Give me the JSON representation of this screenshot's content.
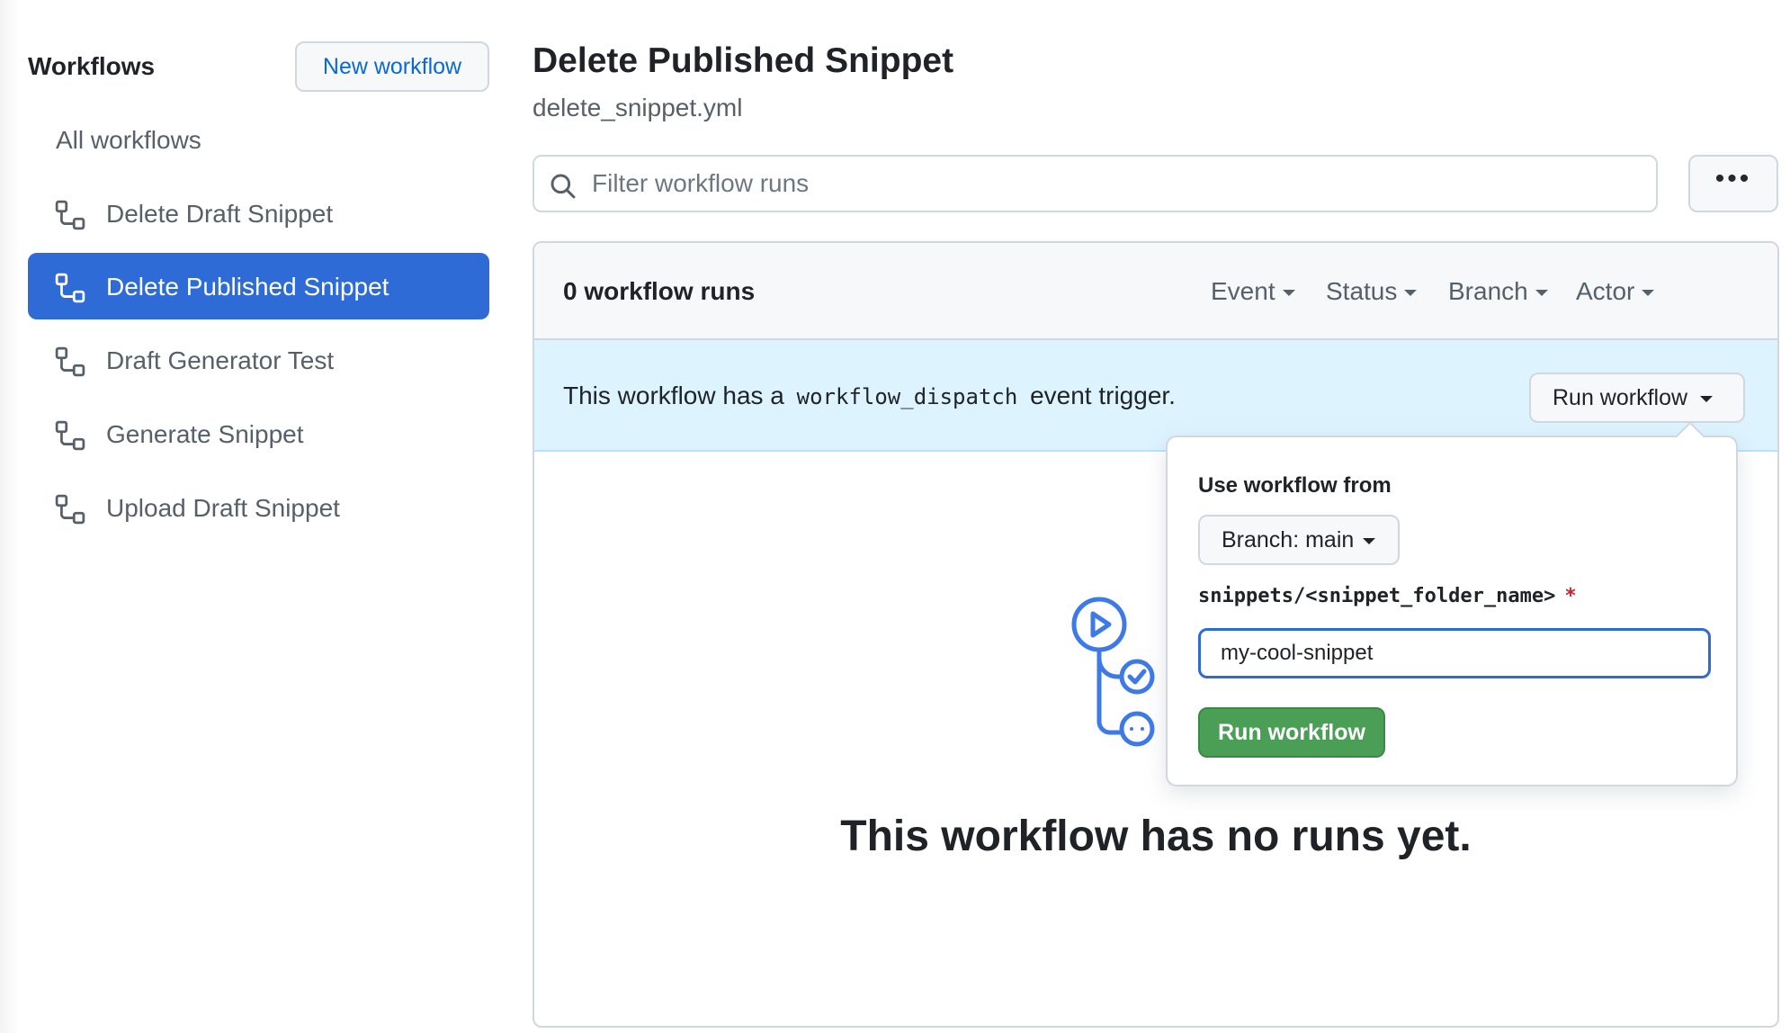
{
  "sidebar": {
    "title": "Workflows",
    "new_workflow_label": "New workflow",
    "all_workflows_label": "All workflows",
    "items": [
      {
        "label": "Delete Draft Snippet",
        "active": false
      },
      {
        "label": "Delete Published Snippet",
        "active": true
      },
      {
        "label": "Draft Generator Test",
        "active": false
      },
      {
        "label": "Generate Snippet",
        "active": false
      },
      {
        "label": "Upload Draft Snippet",
        "active": false
      }
    ]
  },
  "header": {
    "title": "Delete Published Snippet",
    "filename": "delete_snippet.yml"
  },
  "search": {
    "placeholder": "Filter workflow runs"
  },
  "runs": {
    "count_label": "0 workflow runs",
    "filters": [
      "Event",
      "Status",
      "Branch",
      "Actor"
    ]
  },
  "dispatch": {
    "text_before": "This workflow has a",
    "code": "workflow_dispatch",
    "text_after": "event trigger.",
    "run_button_label": "Run workflow"
  },
  "popover": {
    "use_from_label": "Use workflow from",
    "branch_label": "Branch: main",
    "input_label": "snippets/<snippet_folder_name>",
    "required_mark": "*",
    "input_value": "my-cool-snippet",
    "submit_label": "Run workflow"
  },
  "empty_state": {
    "message": "This workflow has no runs yet."
  },
  "colors": {
    "accent": "#2f6bd6",
    "link": "#0969da",
    "success": "#4b9e55",
    "dispatch_bg": "#ddf4ff",
    "required": "#cf222e"
  },
  "icons": {
    "workflow": "workflow-icon",
    "search": "search-icon",
    "more": "kebab-horizontal-icon",
    "empty": "actions-empty-illustration"
  }
}
